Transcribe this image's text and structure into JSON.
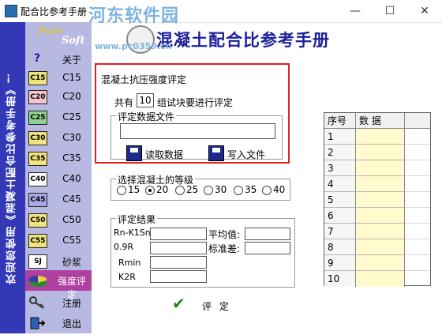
{
  "window": {
    "title": "配合比参考手册",
    "watermark": "河东软件园",
    "minimize": "—",
    "maximize": "☐",
    "close": "✕"
  },
  "banner": {
    "text": "欢迎您使用《混凝土配合比参考手册》！"
  },
  "logo": {
    "line1": "Pure",
    "line2": "Soft"
  },
  "header": {
    "title": "混凝土配合比参考手册",
    "watermark_url": "www.pc0359.cn"
  },
  "sidebar": {
    "items": [
      {
        "icon": "?",
        "label": "关于",
        "icon_name": "help-icon"
      },
      {
        "icon": "C15",
        "label": "C15",
        "icon_name": "c15-icon"
      },
      {
        "icon": "C20",
        "label": "C20",
        "icon_name": "c20-icon"
      },
      {
        "icon": "C25",
        "label": "C25",
        "icon_name": "c25-icon"
      },
      {
        "icon": "C30",
        "label": "C30",
        "icon_name": "c30-icon"
      },
      {
        "icon": "C35",
        "label": "C35",
        "icon_name": "c35-icon"
      },
      {
        "icon": "C40",
        "label": "C40",
        "icon_name": "c40-icon"
      },
      {
        "icon": "C45",
        "label": "C45",
        "icon_name": "c45-icon"
      },
      {
        "icon": "C50",
        "label": "C50",
        "icon_name": "c50-icon"
      },
      {
        "icon": "C55",
        "label": "C55",
        "icon_name": "c55-icon"
      },
      {
        "icon": "SJ",
        "label": "砂浆",
        "icon_name": "mortar-icon"
      },
      {
        "icon": "",
        "label": "强度评定",
        "icon_name": "chart-icon"
      },
      {
        "icon": "",
        "label": "注册",
        "icon_name": "key-icon"
      },
      {
        "icon": "",
        "label": "退出",
        "icon_name": "exit-icon"
      }
    ],
    "selected_index": 11
  },
  "form": {
    "section_title": "混凝土抗压强度评定",
    "count_prefix": "共有",
    "count_value": "10",
    "count_suffix": "组试块要进行评定",
    "file_group_label": "评定数据文件",
    "file_path": "",
    "read_button": "读取数据",
    "write_button": "写入文件",
    "grade_group_label": "选择混凝土的等级",
    "grades": [
      "15",
      "20",
      "25",
      "30",
      "35",
      "40"
    ],
    "selected_grade": "20",
    "result_group_label": "评定结果",
    "results": {
      "rn_label": "Rn-K1Sn",
      "r09_label": "0.9R",
      "rmin_label": "Rmin",
      "k2r_label": "K2R",
      "avg_label": "平均值:",
      "std_label": "标准差:"
    },
    "evaluate_button": "评定"
  },
  "table": {
    "headers": [
      "序号",
      "数 据"
    ],
    "rows": [
      "1",
      "2",
      "3",
      "4",
      "5",
      "6",
      "7",
      "8",
      "9",
      "10"
    ]
  }
}
